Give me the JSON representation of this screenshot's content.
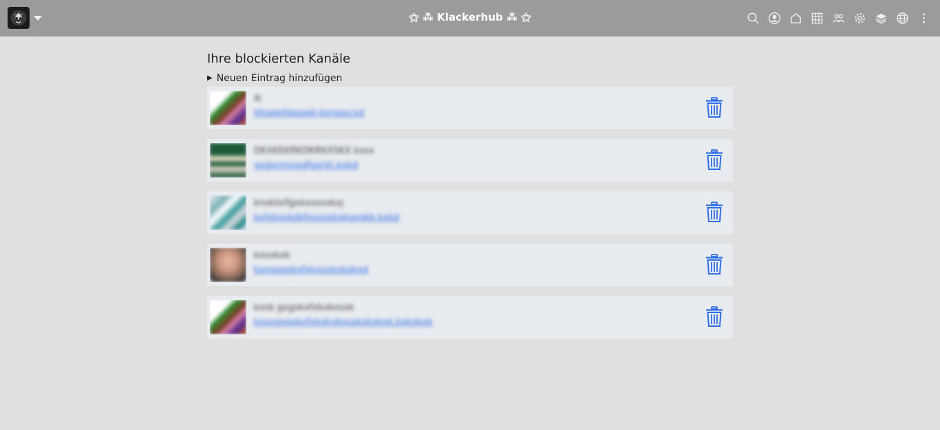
{
  "navbar": {
    "brand": "⚝ ⁂ Klackerhub ⁂ ⚝",
    "icons": [
      "search-icon",
      "user-icon",
      "home-icon",
      "grid-icon",
      "people-icon",
      "settings-icon",
      "layers-icon",
      "globe-icon",
      "more-icon"
    ]
  },
  "page": {
    "title": "Ihre blockierten Kanäle",
    "add_entry": "Neuen Eintrag hinzufügen"
  },
  "channels": [
    {
      "name": "ik",
      "url": "kfsxepfdsgxet-ksrgsxcxd"
    },
    {
      "name": "DKXKEKRKDKRKXSKX ksxx",
      "url": "gxdxrrmsxdfgxrkt.kxkd"
    },
    {
      "name": "knsktxlfgxkxsxsxkxj",
      "url": "kxfxkxskdkfxsxsxkxkgxgkk.kxkd"
    },
    {
      "name": "kxsxkxk",
      "url": "kxxgxgxkxfxkxsxkxkxkxd"
    },
    {
      "name": "kxsk gxgxkxfxkxkxsxk",
      "url": "kxsxgxgxkxfxkxkxkxsxkxkxkxk.kxkxkxk"
    }
  ],
  "colors": {
    "navbar": "#9b9b9b",
    "background": "#e0e0e0",
    "row": "#e8ebef",
    "accent": "#2f6fe8"
  }
}
